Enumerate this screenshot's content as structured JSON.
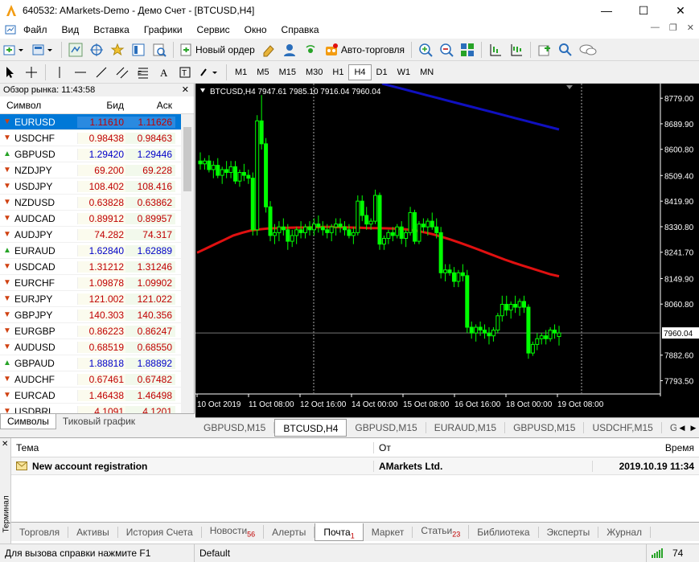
{
  "window": {
    "title": "640532: AMarkets-Demo - Демо Счет - [BTCUSD,H4]",
    "controls": {
      "minimize": "—",
      "maximize": "☐",
      "close": "✕"
    }
  },
  "menu": [
    "Файл",
    "Вид",
    "Вставка",
    "Графики",
    "Сервис",
    "Окно",
    "Справка"
  ],
  "mdi_controls": {
    "minimize": "—",
    "restore": "❐",
    "close": "✕"
  },
  "toolbar1": {
    "new_order_label": "Новый ордер",
    "auto_trading_label": "Авто-торговля"
  },
  "timeframes": [
    "M1",
    "M5",
    "M15",
    "M30",
    "H1",
    "H4",
    "D1",
    "W1",
    "MN"
  ],
  "active_timeframe": "H4",
  "market_watch": {
    "title": "Обзор рынка: 11:43:58",
    "close": "✕",
    "col_symbol": "Символ",
    "col_bid": "Бид",
    "col_ask": "Аск",
    "rows": [
      {
        "symbol": "EURUSD",
        "bid": "1.11610",
        "ask": "1.11626",
        "dir": "down",
        "selected": true
      },
      {
        "symbol": "USDCHF",
        "bid": "0.98438",
        "ask": "0.98463",
        "dir": "down"
      },
      {
        "symbol": "GBPUSD",
        "bid": "1.29420",
        "ask": "1.29446",
        "dir": "up"
      },
      {
        "symbol": "NZDJPY",
        "bid": "69.200",
        "ask": "69.228",
        "dir": "down"
      },
      {
        "symbol": "USDJPY",
        "bid": "108.402",
        "ask": "108.416",
        "dir": "down"
      },
      {
        "symbol": "NZDUSD",
        "bid": "0.63828",
        "ask": "0.63862",
        "dir": "down"
      },
      {
        "symbol": "AUDCAD",
        "bid": "0.89912",
        "ask": "0.89957",
        "dir": "down"
      },
      {
        "symbol": "AUDJPY",
        "bid": "74.282",
        "ask": "74.317",
        "dir": "down"
      },
      {
        "symbol": "EURAUD",
        "bid": "1.62840",
        "ask": "1.62889",
        "dir": "up"
      },
      {
        "symbol": "USDCAD",
        "bid": "1.31212",
        "ask": "1.31246",
        "dir": "down"
      },
      {
        "symbol": "EURCHF",
        "bid": "1.09878",
        "ask": "1.09902",
        "dir": "down"
      },
      {
        "symbol": "EURJPY",
        "bid": "121.002",
        "ask": "121.022",
        "dir": "down"
      },
      {
        "symbol": "GBPJPY",
        "bid": "140.303",
        "ask": "140.356",
        "dir": "down"
      },
      {
        "symbol": "EURGBP",
        "bid": "0.86223",
        "ask": "0.86247",
        "dir": "down"
      },
      {
        "symbol": "AUDUSD",
        "bid": "0.68519",
        "ask": "0.68550",
        "dir": "down"
      },
      {
        "symbol": "GBPAUD",
        "bid": "1.88818",
        "ask": "1.88892",
        "dir": "up"
      },
      {
        "symbol": "AUDCHF",
        "bid": "0.67461",
        "ask": "0.67482",
        "dir": "down"
      },
      {
        "symbol": "EURCAD",
        "bid": "1.46438",
        "ask": "1.46498",
        "dir": "down"
      },
      {
        "symbol": "USDBRL",
        "bid": "4.1091",
        "ask": "4.1201",
        "dir": "down"
      }
    ],
    "tabs": [
      "Символы",
      "Тиковый график"
    ]
  },
  "chart": {
    "header": "BTCUSD,H4  7947.61 7985.10 7916.04 7960.04",
    "current_price": "7960.04",
    "price_ticks": [
      "8779.00",
      "8689.90",
      "8600.80",
      "8509.40",
      "8419.90",
      "8330.80",
      "8241.70",
      "8149.90",
      "8060.80",
      "7960.04",
      "7882.60",
      "7793.50"
    ],
    "time_ticks": [
      "10 Oct 2019",
      "11 Oct 08:00",
      "12 Oct 16:00",
      "14 Oct 00:00",
      "15 Oct 08:00",
      "16 Oct 16:00",
      "18 Oct 00:00",
      "19 Oct 08:00"
    ],
    "colors": {
      "bull": "#00ff00",
      "ma_red": "#e01010",
      "ma_blue": "#1010c0",
      "background": "#000000"
    }
  },
  "chart_data": {
    "type": "candlestick",
    "symbol": "BTCUSD",
    "timeframe": "H4",
    "ohlc_last": {
      "open": 7947.61,
      "high": 7985.1,
      "low": 7916.04,
      "close": 7960.04
    },
    "ylim": [
      7750,
      8830
    ],
    "x": [
      "10 Oct 2019",
      "11 Oct 08:00",
      "12 Oct 16:00",
      "14 Oct 00:00",
      "15 Oct 08:00",
      "16 Oct 16:00",
      "18 Oct 00:00",
      "19 Oct 08:00"
    ],
    "candles": [
      [
        8560,
        8590,
        8530,
        8550
      ],
      [
        8550,
        8570,
        8530,
        8560
      ],
      [
        8560,
        8580,
        8520,
        8530
      ],
      [
        8530,
        8560,
        8500,
        8545
      ],
      [
        8545,
        8570,
        8500,
        8510
      ],
      [
        8510,
        8540,
        8480,
        8530
      ],
      [
        8530,
        8560,
        8500,
        8520
      ],
      [
        8520,
        8560,
        8500,
        8540
      ],
      [
        8540,
        8560,
        8480,
        8490
      ],
      [
        8490,
        8530,
        8470,
        8520
      ],
      [
        8520,
        8550,
        8490,
        8510
      ],
      [
        8510,
        8530,
        8480,
        8500
      ],
      [
        8500,
        8520,
        8300,
        8320
      ],
      [
        8320,
        8720,
        8300,
        8700
      ],
      [
        8700,
        8790,
        8600,
        8620
      ],
      [
        8620,
        8640,
        8380,
        8400
      ],
      [
        8400,
        8420,
        8280,
        8300
      ],
      [
        8300,
        8340,
        8270,
        8310
      ],
      [
        8310,
        8350,
        8280,
        8330
      ],
      [
        8330,
        8360,
        8300,
        8320
      ],
      [
        8320,
        8340,
        8250,
        8280
      ],
      [
        8280,
        8320,
        8260,
        8300
      ],
      [
        8300,
        8330,
        8270,
        8320
      ],
      [
        8320,
        8350,
        8290,
        8310
      ],
      [
        8310,
        8340,
        8290,
        8330
      ],
      [
        8330,
        8350,
        8300,
        8320
      ],
      [
        8320,
        8360,
        8300,
        8340
      ],
      [
        8340,
        8370,
        8310,
        8330
      ],
      [
        8330,
        8350,
        8300,
        8320
      ],
      [
        8320,
        8340,
        8290,
        8310
      ],
      [
        8310,
        8340,
        8280,
        8330
      ],
      [
        8330,
        8360,
        8300,
        8340
      ],
      [
        8340,
        8360,
        8310,
        8330
      ],
      [
        8330,
        8350,
        8300,
        8320
      ],
      [
        8320,
        8340,
        8290,
        8300
      ],
      [
        8300,
        8330,
        8270,
        8310
      ],
      [
        8310,
        8440,
        8300,
        8420
      ],
      [
        8420,
        8440,
        8350,
        8370
      ],
      [
        8370,
        8400,
        8320,
        8340
      ],
      [
        8340,
        8360,
        8320,
        8350
      ],
      [
        8350,
        8460,
        8340,
        8440
      ],
      [
        8440,
        8450,
        8250,
        8270
      ],
      [
        8270,
        8300,
        8250,
        8290
      ],
      [
        8290,
        8320,
        8270,
        8310
      ],
      [
        8310,
        8330,
        8280,
        8300
      ],
      [
        8300,
        8340,
        8290,
        8330
      ],
      [
        8330,
        8350,
        8270,
        8290
      ],
      [
        8290,
        8320,
        8260,
        8310
      ],
      [
        8310,
        8400,
        8300,
        8380
      ],
      [
        8380,
        8390,
        8270,
        8280
      ],
      [
        8280,
        8350,
        8270,
        8340
      ],
      [
        8340,
        8360,
        8310,
        8330
      ],
      [
        8330,
        8360,
        8300,
        8350
      ],
      [
        8350,
        8380,
        8320,
        8330
      ],
      [
        8330,
        8360,
        8290,
        8310
      ],
      [
        8310,
        8330,
        8150,
        8170
      ],
      [
        8170,
        8200,
        8140,
        8180
      ],
      [
        8180,
        8200,
        8160,
        8170
      ],
      [
        8170,
        8190,
        8120,
        8140
      ],
      [
        8140,
        8180,
        8120,
        8170
      ],
      [
        8170,
        8200,
        8140,
        8160
      ],
      [
        8160,
        8180,
        7960,
        7980
      ],
      [
        7980,
        8000,
        7940,
        7960
      ],
      [
        7960,
        7990,
        7930,
        7980
      ],
      [
        7980,
        8000,
        7950,
        7970
      ],
      [
        7970,
        7990,
        7940,
        7960
      ],
      [
        7960,
        7980,
        7920,
        7950
      ],
      [
        7950,
        7980,
        7930,
        7970
      ],
      [
        7970,
        8030,
        7960,
        8020
      ],
      [
        8020,
        8090,
        8000,
        8060
      ],
      [
        8060,
        8090,
        8020,
        8040
      ],
      [
        8040,
        8070,
        8010,
        8060
      ],
      [
        8060,
        8090,
        8030,
        8050
      ],
      [
        8050,
        8080,
        8020,
        8070
      ],
      [
        8070,
        8090,
        8030,
        8050
      ],
      [
        8050,
        8060,
        7870,
        7890
      ],
      [
        7890,
        7930,
        7880,
        7920
      ],
      [
        7920,
        7960,
        7900,
        7940
      ],
      [
        7940,
        7960,
        7920,
        7950
      ],
      [
        7950,
        7970,
        7920,
        7940
      ],
      [
        7940,
        7980,
        7930,
        7970
      ],
      [
        7970,
        7990,
        7940,
        7960
      ],
      [
        7947.61,
        7985.1,
        7916.04,
        7960.04
      ]
    ],
    "ma_red": [
      8240,
      8255,
      8270,
      8285,
      8300,
      8310,
      8318,
      8322,
      8325,
      8326,
      8327,
      8328,
      8328,
      8329,
      8330,
      8330,
      8329,
      8328,
      8327,
      8326,
      8326,
      8325,
      8324,
      8322,
      8318,
      8312,
      8305,
      8296,
      8286,
      8275,
      8264,
      8252,
      8240,
      8228,
      8216,
      8205,
      8195,
      8185,
      8175,
      8165,
      8158
    ],
    "ma_blue": [
      8830,
      8820,
      8810,
      8800,
      8790,
      8780,
      8770,
      8760,
      8750,
      8740,
      8730,
      8720,
      8710,
      8700,
      8690,
      8680,
      8670
    ]
  },
  "chart_tabs": [
    "GBPUSD,M15",
    "BTCUSD,H4",
    "GBPUSD,M15",
    "EURAUD,M15",
    "GBPUSD,M15",
    "USDCHF,M15",
    "GBPU"
  ],
  "active_chart_tab": 1,
  "terminal": {
    "side_label": "Терминал",
    "close": "✕",
    "col_subject": "Тема",
    "col_from": "От",
    "col_time": "Время",
    "messages": [
      {
        "subject": "New account registration",
        "from": "AMarkets Ltd.",
        "time": "2019.10.19 11:34"
      }
    ],
    "tabs": [
      {
        "label": "Торговля"
      },
      {
        "label": "Активы"
      },
      {
        "label": "История Счета"
      },
      {
        "label": "Новости",
        "badge": "56"
      },
      {
        "label": "Алерты"
      },
      {
        "label": "Почта",
        "badge": "1",
        "active": true
      },
      {
        "label": "Маркет"
      },
      {
        "label": "Статьи",
        "badge": "23"
      },
      {
        "label": "Библиотека"
      },
      {
        "label": "Эксперты"
      },
      {
        "label": "Журнал"
      }
    ]
  },
  "status": {
    "help": "Для вызова справки нажмите F1",
    "profile": "Default",
    "connection_kb": "74"
  }
}
